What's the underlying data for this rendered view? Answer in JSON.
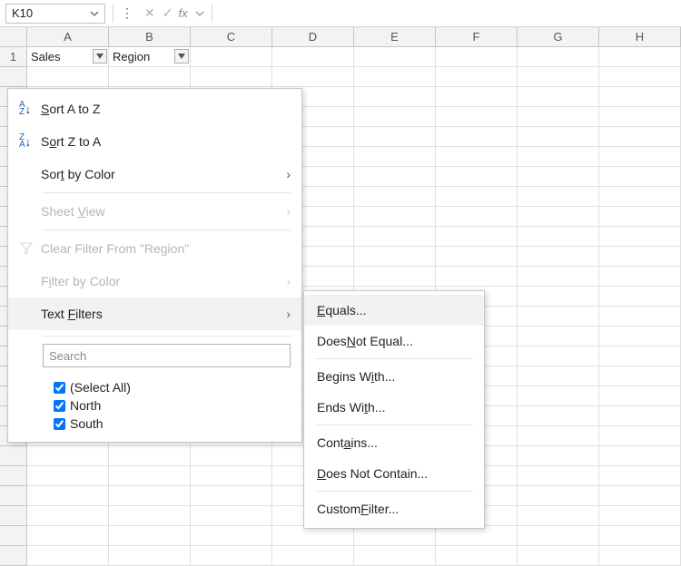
{
  "formula_bar": {
    "name_box": "K10",
    "cancel_glyph": "✕",
    "accept_glyph": "✓",
    "fx_label": "fx"
  },
  "columns": [
    "A",
    "B",
    "C",
    "D",
    "E",
    "F",
    "G",
    "H"
  ],
  "row1_label": "1",
  "headers": {
    "A": "Sales",
    "B": "Region"
  },
  "filter_menu": {
    "sort_az": "Sort A to Z",
    "sort_za": "Sort Z to A",
    "sort_color": "Sort by Color",
    "sheet_view": "Sheet View",
    "clear_filter": "Clear Filter From \"Region\"",
    "filter_color": "Filter by Color",
    "text_filters": "Text Filters",
    "search_placeholder": "Search",
    "select_all": "(Select All)",
    "values": [
      "North",
      "South"
    ]
  },
  "text_filters_submenu": {
    "equals": "Equals...",
    "not_equal": "Does Not Equal...",
    "begins_with": "Begins With...",
    "ends_with": "Ends With...",
    "contains": "Contains...",
    "not_contain": "Does Not Contain...",
    "custom": "Custom Filter..."
  }
}
